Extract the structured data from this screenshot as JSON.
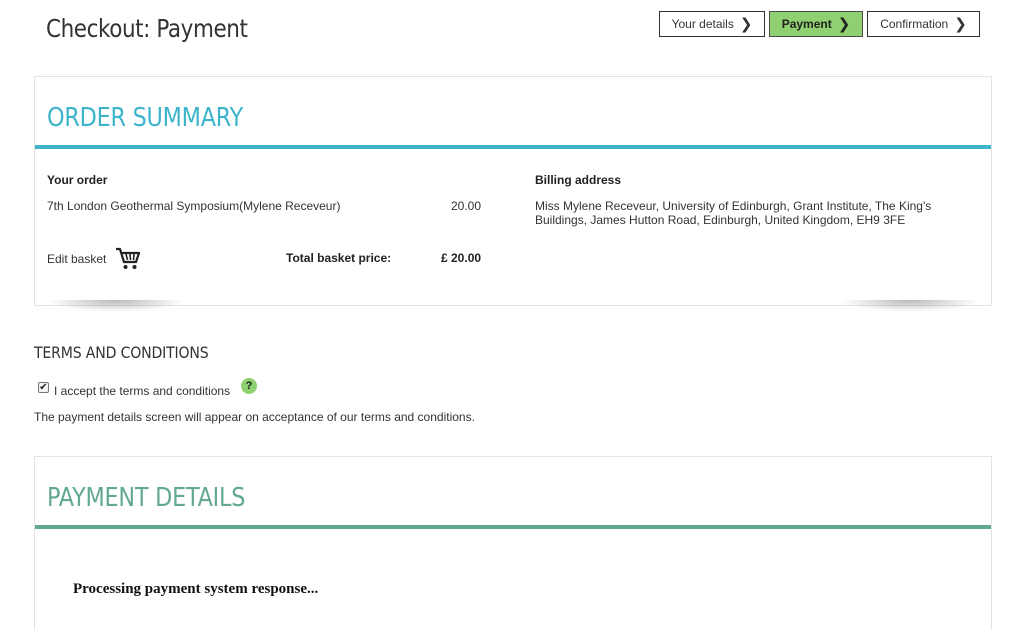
{
  "header": {
    "title": "Checkout: Payment",
    "steps": [
      {
        "label": "Your details",
        "active": false
      },
      {
        "label": "Payment",
        "active": true
      },
      {
        "label": "Confirmation",
        "active": false
      }
    ]
  },
  "order_summary": {
    "heading": "ORDER SUMMARY",
    "your_order_label": "Your order",
    "item_name": "7th London Geothermal Symposium(Mylene Receveur)",
    "item_price": "20.00",
    "edit_basket_label": "Edit basket",
    "total_label": "Total basket price:",
    "total_value": "£ 20.00",
    "billing_label": "Billing address",
    "billing_line1": "Miss Mylene Receveur, University of Edinburgh, Grant Institute, The King's",
    "billing_line2": "Buildings, James Hutton Road, Edinburgh, United Kingdom, EH9 3FE"
  },
  "terms": {
    "heading": "TERMS AND CONDITIONS",
    "checkbox_label": "I accept the terms and conditions",
    "checked": true,
    "help_glyph": "?",
    "note": "The payment details screen will appear on acceptance of our terms and conditions."
  },
  "payment": {
    "heading": "PAYMENT DETAILS",
    "processing_text": "Processing payment system response..."
  },
  "colors": {
    "summary_accent": "#3db4cc",
    "payment_accent": "#62a892",
    "active_step": "#8fd170"
  },
  "icons": {
    "chevron": "❯",
    "checkmark": "✔",
    "cart": "shopping-cart-icon"
  }
}
